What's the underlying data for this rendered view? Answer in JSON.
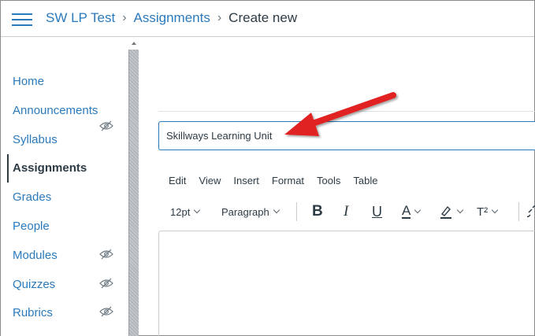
{
  "header": {
    "breadcrumb": [
      "SW LP Test",
      "Assignments",
      "Create new"
    ],
    "separator": "›"
  },
  "sidebar": {
    "items": [
      {
        "label": "Home",
        "hidden": false
      },
      {
        "label": "Announcements",
        "hidden": true
      },
      {
        "label": "Syllabus",
        "hidden": false
      },
      {
        "label": "Assignments",
        "hidden": false,
        "active": true
      },
      {
        "label": "Grades",
        "hidden": false
      },
      {
        "label": "People",
        "hidden": false
      },
      {
        "label": "Modules",
        "hidden": true
      },
      {
        "label": "Quizzes",
        "hidden": true
      },
      {
        "label": "Rubrics",
        "hidden": true
      }
    ]
  },
  "main": {
    "title_value": "Skillways Learning Unit",
    "menubar": [
      "Edit",
      "View",
      "Insert",
      "Format",
      "Tools",
      "Table"
    ],
    "toolbar": {
      "font_size": "12pt",
      "block_format": "Paragraph",
      "bold": "B",
      "italic": "I",
      "underline": "U",
      "text_color": "A",
      "superscript": "T²"
    }
  },
  "colors": {
    "link": "#2b7abc",
    "text": "#2d3b45",
    "annotation_arrow": "#e02020"
  },
  "icons": [
    "hamburger-menu-icon",
    "eye-slash-icon",
    "text-color-icon",
    "highlight-icon",
    "superscript-icon",
    "link-icon",
    "red-arrow-annotation"
  ]
}
